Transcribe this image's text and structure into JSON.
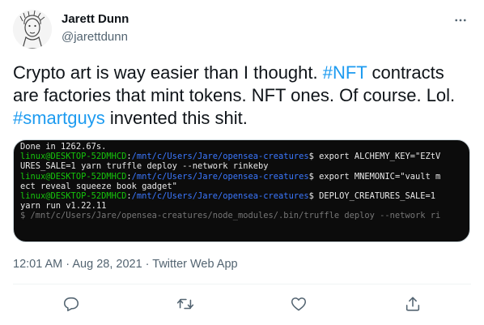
{
  "author": {
    "name": "Jarett Dunn",
    "handle": "@jarettdunn"
  },
  "tweet": {
    "text_parts": [
      "Crypto art is way easier than I thought. ",
      "#NFT",
      " contracts are factories that mint tokens. NFT ones. Of course. Lol. ",
      "#smartguys",
      " invented this shit."
    ]
  },
  "terminal": {
    "lines": [
      [
        {
          "t": "Done in 1262.67s.",
          "c": "text"
        }
      ],
      [
        {
          "t": "linux@DESKTOP-52DMHCD",
          "c": "user"
        },
        {
          "t": ":",
          "c": "text"
        },
        {
          "t": "/mnt/c/Users/Jare/opensea-creatures",
          "c": "path"
        },
        {
          "t": "$ export ALCHEMY_KEY=\"EZtV",
          "c": "text"
        }
      ],
      [
        {
          "t": "URES_SALE=1 yarn truffle deploy --network rinkeby",
          "c": "text"
        }
      ],
      [
        {
          "t": "linux@DESKTOP-52DMHCD",
          "c": "user"
        },
        {
          "t": ":",
          "c": "text"
        },
        {
          "t": "/mnt/c/Users/Jare/opensea-creatures",
          "c": "path"
        },
        {
          "t": "$ export MNEMONIC=\"vault m",
          "c": "text"
        }
      ],
      [
        {
          "t": "ect reveal squeeze book gadget\"",
          "c": "text"
        }
      ],
      [
        {
          "t": "linux@DESKTOP-52DMHCD",
          "c": "user"
        },
        {
          "t": ":",
          "c": "text"
        },
        {
          "t": "/mnt/c/Users/Jare/opensea-creatures",
          "c": "path"
        },
        {
          "t": "$ DEPLOY_CREATURES_SALE=1",
          "c": "text"
        }
      ],
      [
        {
          "t": "yarn run v1.22.11",
          "c": "text"
        }
      ],
      [
        {
          "t": "$ /mnt/c/Users/Jare/opensea-creatures/node_modules/.bin/truffle deploy --network ri",
          "c": "dim"
        }
      ]
    ]
  },
  "meta": {
    "time": "12:01 AM",
    "separator": " · ",
    "date": "Aug 28, 2021",
    "source": "Twitter Web App"
  },
  "icons": {
    "more": "more-horizontal-icon",
    "reply": "reply-icon",
    "retweet": "retweet-icon",
    "like": "heart-icon",
    "share": "share-icon"
  },
  "colors": {
    "accent": "#1d9bf0",
    "secondary_text": "#536471",
    "terminal_user": "#16c60c",
    "terminal_path": "#3b78ff"
  }
}
